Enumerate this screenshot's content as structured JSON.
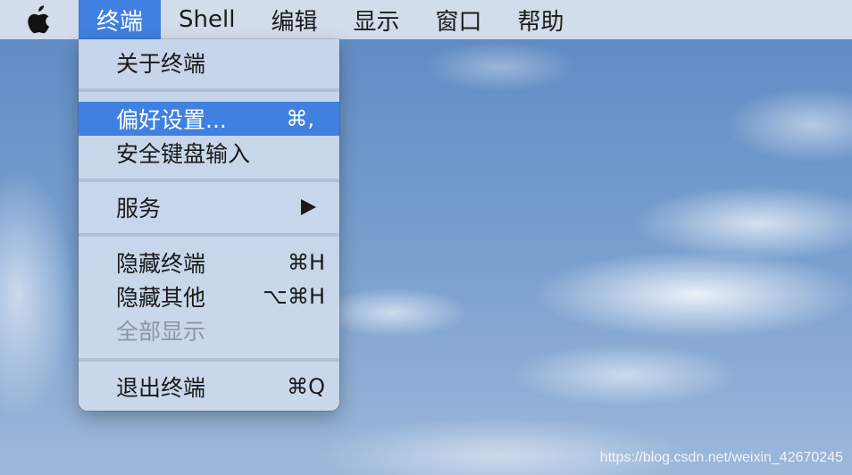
{
  "menubar": {
    "apple_icon": "apple-logo-icon",
    "items": [
      {
        "label": "终端"
      },
      {
        "label": "Shell"
      },
      {
        "label": "编辑"
      },
      {
        "label": "显示"
      },
      {
        "label": "窗口"
      },
      {
        "label": "帮助"
      }
    ]
  },
  "dropdown": {
    "items": [
      {
        "label": "关于终端",
        "shortcut": ""
      },
      {
        "label": "偏好设置...",
        "shortcut": "⌘,"
      },
      {
        "label": "安全键盘输入",
        "shortcut": ""
      },
      {
        "label": "服务",
        "shortcut": ""
      },
      {
        "label": "隐藏终端",
        "shortcut": "⌘H"
      },
      {
        "label": "隐藏其他",
        "shortcut": "⌥⌘H"
      },
      {
        "label": "全部显示",
        "shortcut": ""
      },
      {
        "label": "退出终端",
        "shortcut": "⌘Q"
      }
    ]
  },
  "watermark": "https://blog.csdn.net/weixin_42670245",
  "colors": {
    "highlight": "#3f80e0",
    "menubar_bg": "#d2dcea",
    "menu_bg": "#cedaec",
    "disabled_text": "#8e96a3"
  }
}
